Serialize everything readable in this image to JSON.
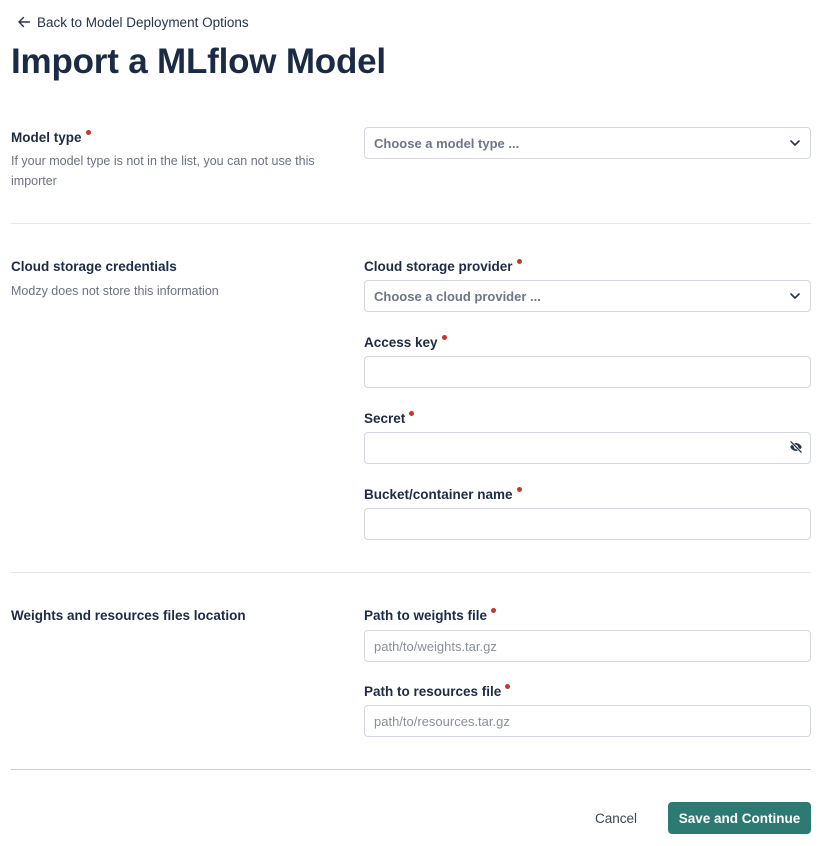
{
  "nav": {
    "back_label": "Back to Model Deployment Options"
  },
  "page": {
    "title": "Import a MLflow Model"
  },
  "model_type": {
    "label": "Model type",
    "help": "If your model type is not in the list, you can not use this importer",
    "select": {
      "placeholder": "Choose a model type ...",
      "required": true
    }
  },
  "credentials": {
    "label": "Cloud storage credentials",
    "help": "Modzy does not store this information",
    "provider": {
      "label": "Cloud storage provider",
      "placeholder": "Choose a cloud provider ...",
      "required": true
    },
    "access_key": {
      "label": "Access key",
      "value": "",
      "required": true
    },
    "secret": {
      "label": "Secret",
      "value": "",
      "required": true,
      "icon": "eye-slash-icon"
    },
    "bucket": {
      "label": "Bucket/container name",
      "value": "",
      "required": true
    }
  },
  "files": {
    "label": "Weights and resources files location",
    "weights": {
      "label": "Path to weights file",
      "placeholder": "path/to/weights.tar.gz",
      "required": true
    },
    "resources": {
      "label": "Path to resources file",
      "placeholder": "path/to/resources.tar.gz",
      "required": true
    }
  },
  "footer": {
    "cancel_label": "Cancel",
    "save_label": "Save and Continue"
  },
  "colors": {
    "primary": "#2d7a72",
    "required_dot": "#c0392b",
    "title": "#1b2a45",
    "border": "#d3d7de"
  }
}
